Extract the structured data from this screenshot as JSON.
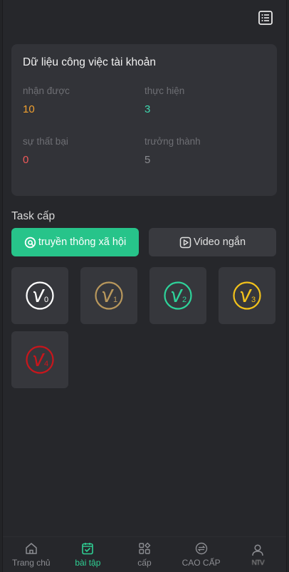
{
  "header": {
    "menu_icon": "list-icon"
  },
  "account_card": {
    "title": "Dữ liệu công việc tài khoản",
    "stats": [
      {
        "label": "nhận được",
        "value": "10",
        "color": "#f0a030"
      },
      {
        "label": "thực hiện",
        "value": "3",
        "color": "#3fd9b0"
      },
      {
        "label": "sự thất bại",
        "value": "0",
        "color": "#ef5a5a"
      },
      {
        "label": "trưởng thành",
        "value": "5",
        "color": "#8b8c90"
      }
    ]
  },
  "task_section": {
    "title": "Task cấp",
    "tabs": [
      {
        "label": "truyền thông xã hội",
        "icon": "social-media-icon",
        "active": true
      },
      {
        "label": "Video ngắn",
        "icon": "play-icon",
        "active": false
      }
    ]
  },
  "levels": [
    {
      "label": "0",
      "color": "#ffffff",
      "icon": "vip-badge-icon"
    },
    {
      "label": "1",
      "color": "#b8975c",
      "icon": "vip-badge-icon"
    },
    {
      "label": "2",
      "color": "#2ed39a",
      "icon": "vip-badge-icon"
    },
    {
      "label": "3",
      "color": "#f2c21b",
      "icon": "vip-badge-icon"
    },
    {
      "label": "4",
      "color": "#c8161c",
      "icon": "vip-badge-icon"
    }
  ],
  "bottom_nav": [
    {
      "label": "Trang chủ",
      "icon": "home-icon",
      "active": false
    },
    {
      "label": "bài tập",
      "icon": "task-icon",
      "active": true
    },
    {
      "label": "cấp",
      "icon": "grid-icon",
      "active": false
    },
    {
      "label": "CAO CẤP",
      "icon": "exchange-icon",
      "active": false
    },
    {
      "label": "NTV",
      "icon": "user-icon",
      "active": false
    }
  ],
  "colors": {
    "accent": "#27c48a",
    "background": "#26272b",
    "card": "#323338"
  }
}
